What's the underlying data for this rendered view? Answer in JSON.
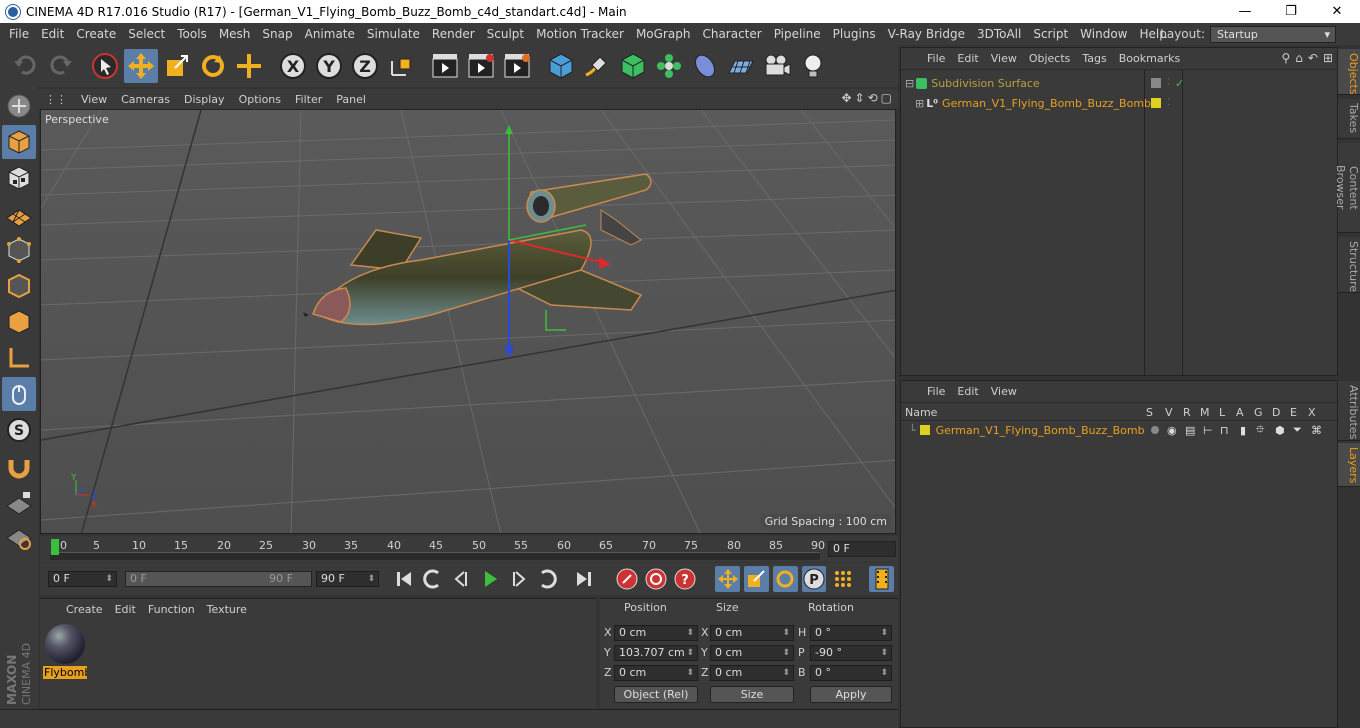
{
  "window": {
    "title": "CINEMA 4D R17.016 Studio (R17) - [German_V1_Flying_Bomb_Buzz_Bomb_c4d_standart.c4d] - Main",
    "minimize": "—",
    "maximize": "❐",
    "close": "✕"
  },
  "menubar": [
    "File",
    "Edit",
    "Create",
    "Select",
    "Tools",
    "Mesh",
    "Snap",
    "Animate",
    "Simulate",
    "Render",
    "Sculpt",
    "Motion Tracker",
    "MoGraph",
    "Character",
    "Pipeline",
    "Plugins",
    "V-Ray Bridge",
    "3DToAll",
    "Script",
    "Window",
    "Help"
  ],
  "layout": {
    "label": "Layout:",
    "value": "Startup"
  },
  "viewport": {
    "menu": [
      "View",
      "Cameras",
      "Display",
      "Options",
      "Filter",
      "Panel"
    ],
    "camera_label": "Perspective",
    "grid_spacing": "Grid Spacing : 100 cm",
    "axis_labels": {
      "y": "Y",
      "x": "X",
      "z": "Z"
    }
  },
  "timeline": {
    "ticks": [
      "0",
      "5",
      "10",
      "15",
      "20",
      "25",
      "30",
      "35",
      "40",
      "45",
      "50",
      "55",
      "60",
      "65",
      "70",
      "75",
      "80",
      "85",
      "90"
    ],
    "current_frame": "0 F"
  },
  "transport": {
    "start": "0 F",
    "slider_start": "0 F",
    "slider_end": "90 F",
    "end": "90 F"
  },
  "material_manager": {
    "menu": [
      "Create",
      "Edit",
      "Function",
      "Texture"
    ],
    "material_name": "Flybomb"
  },
  "coordinates": {
    "headers": {
      "position": "Position",
      "size": "Size",
      "rotation": "Rotation"
    },
    "rows": [
      {
        "pa": "X",
        "pv": "0 cm",
        "sa": "X",
        "sv": "0 cm",
        "ra": "H",
        "rv": "0 °"
      },
      {
        "pa": "Y",
        "pv": "103.707 cm",
        "sa": "Y",
        "sv": "0 cm",
        "ra": "P",
        "rv": "-90 °"
      },
      {
        "pa": "Z",
        "pv": "0 cm",
        "sa": "Z",
        "sv": "0 cm",
        "ra": "B",
        "rv": "0 °"
      }
    ],
    "mode": "Object (Rel)",
    "size_mode": "Size",
    "apply": "Apply"
  },
  "object_manager": {
    "menu": [
      "File",
      "Edit",
      "View",
      "Objects",
      "Tags",
      "Bookmarks"
    ],
    "objects": [
      {
        "name": "Subdivision Surface"
      },
      {
        "name": "German_V1_Flying_Bomb_Buzz_Bomb"
      }
    ]
  },
  "layer_manager": {
    "menu": [
      "File",
      "Edit",
      "View"
    ],
    "columns": [
      "Name",
      "S",
      "V",
      "R",
      "M",
      "L",
      "A",
      "G",
      "D",
      "E",
      "X"
    ],
    "layers": [
      {
        "name": "German_V1_Flying_Bomb_Buzz_Bomb"
      }
    ]
  },
  "side_tabs_top": [
    "Objects",
    "Takes",
    "Content Browser",
    "Structure"
  ],
  "side_tabs_bottom": [
    "Attributes",
    "Layers"
  ],
  "branding": {
    "maxon": "MAXON",
    "product": "CINEMA 4D"
  },
  "colors": {
    "accent": "#5b7ea8",
    "highlight": "#e8a020",
    "panel": "#3a3a3a",
    "viewport": "#555555"
  }
}
